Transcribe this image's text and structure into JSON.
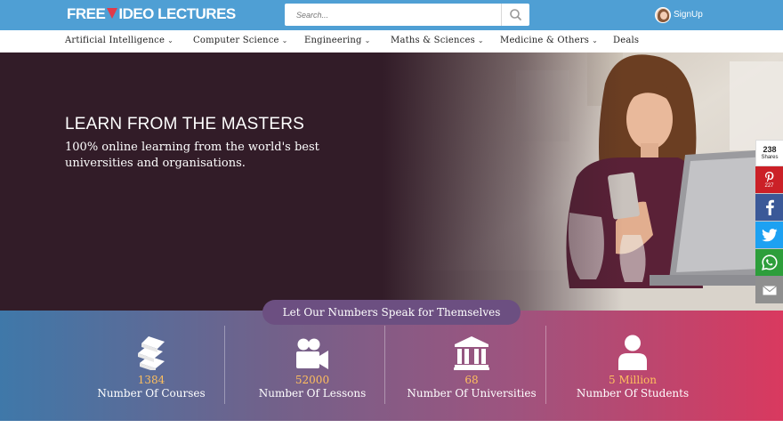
{
  "header": {
    "logo": {
      "part1": "FREE",
      "part2": "IDEO LECTURES"
    },
    "search": {
      "placeholder": "Search..."
    },
    "signup_label": "SignUp"
  },
  "nav": {
    "items": [
      {
        "label": "Artificial Intelligence",
        "has_dropdown": true
      },
      {
        "label": "Computer Science",
        "has_dropdown": true
      },
      {
        "label": "Engineering",
        "has_dropdown": true
      },
      {
        "label": "Maths & Sciences",
        "has_dropdown": true
      },
      {
        "label": "Medicine & Others",
        "has_dropdown": true
      },
      {
        "label": "Deals",
        "has_dropdown": false
      }
    ]
  },
  "hero": {
    "title": "LEARN FROM THE MASTERS",
    "subtitle": "100% online learning from the world's best universities and organisations."
  },
  "share": {
    "total": "238",
    "total_label": "Shares",
    "pinterest_count": "227",
    "buttons": [
      "pinterest-icon",
      "facebook-icon",
      "twitter-icon",
      "whatsapp-icon",
      "email-icon"
    ]
  },
  "stats": {
    "heading": "Let Our Numbers Speak for Themselves",
    "items": [
      {
        "value": "1384",
        "label": "Number Of Courses",
        "icon": "books-icon"
      },
      {
        "value": "52000",
        "label": "Number Of Lessons",
        "icon": "video-camera-icon"
      },
      {
        "value": "68",
        "label": "Number Of Universities",
        "icon": "university-icon"
      },
      {
        "value": "5 Million",
        "label": "Number Of Students",
        "icon": "student-icon"
      }
    ]
  },
  "colors": {
    "header_blue": "#4f9fd4",
    "hero_bg": "#321c28",
    "stat_value": "#ffbf5e",
    "pinterest": "#cb2027",
    "facebook": "#3b5998",
    "twitter": "#1da1f2",
    "whatsapp": "#2d9e3b",
    "email": "#8f8f8f"
  }
}
